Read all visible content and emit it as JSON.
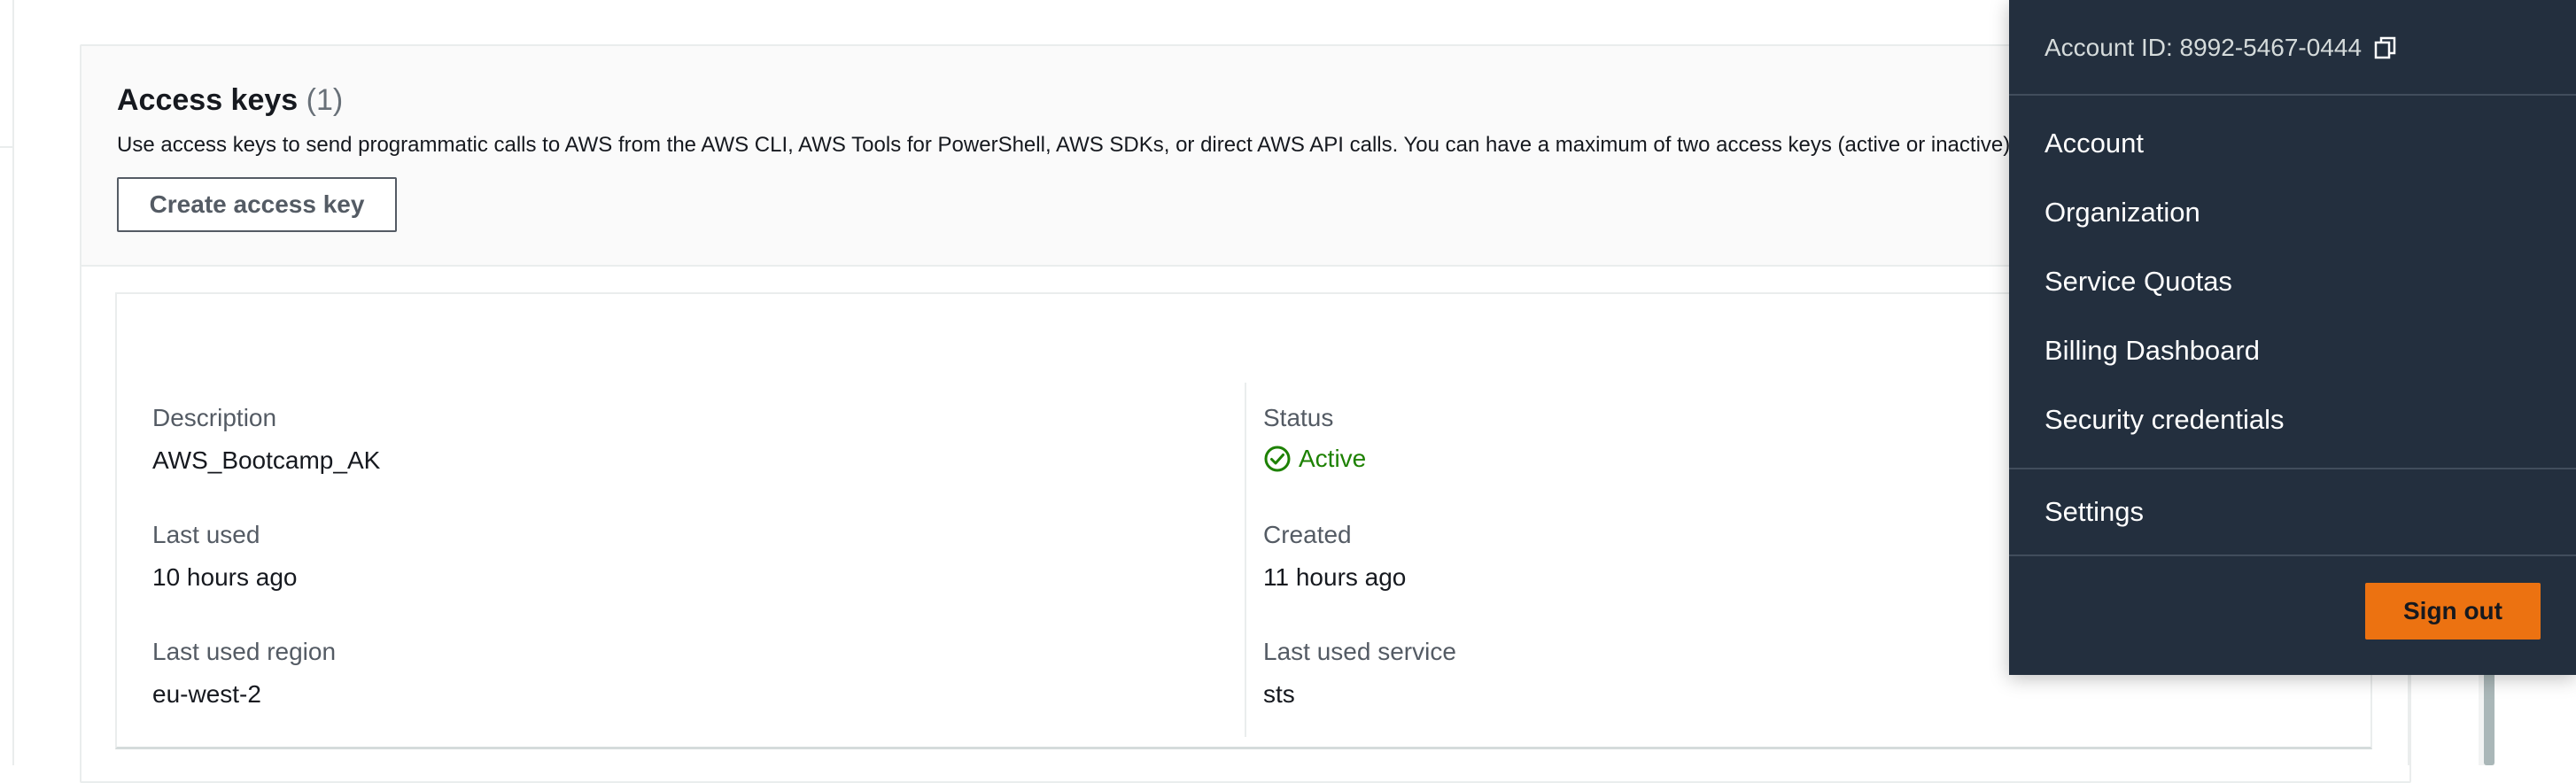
{
  "access_keys": {
    "title": "Access keys",
    "count": "(1)",
    "description": "Use access keys to send programmatic calls to AWS from the AWS CLI, AWS Tools for PowerShell, AWS SDKs, or direct AWS API calls. You can have a maximum of two access keys (active or inactive) at a time.",
    "create_button_label": "Create access key"
  },
  "key": {
    "description_label": "Description",
    "description_value": "AWS_Bootcamp_AK",
    "last_used_label": "Last used",
    "last_used_value": "10 hours ago",
    "last_used_region_label": "Last used region",
    "last_used_region_value": "eu-west-2",
    "status_label": "Status",
    "status_value": "Active",
    "created_label": "Created",
    "created_value": "11 hours ago",
    "last_used_service_label": "Last used service",
    "last_used_service_value": "sts"
  },
  "account_menu": {
    "account_id_text": "Account ID: 8992-5467-0444",
    "items": [
      "Account",
      "Organization",
      "Service Quotas",
      "Billing Dashboard",
      "Security credentials"
    ],
    "settings_label": "Settings",
    "sign_out_label": "Sign out"
  },
  "colors": {
    "menu_bg": "#232f3e",
    "sign_out_button": "#ec7211",
    "status_active": "#1d8102"
  },
  "icons": {
    "copy": "copy-icon",
    "status": "check-circle-icon"
  }
}
